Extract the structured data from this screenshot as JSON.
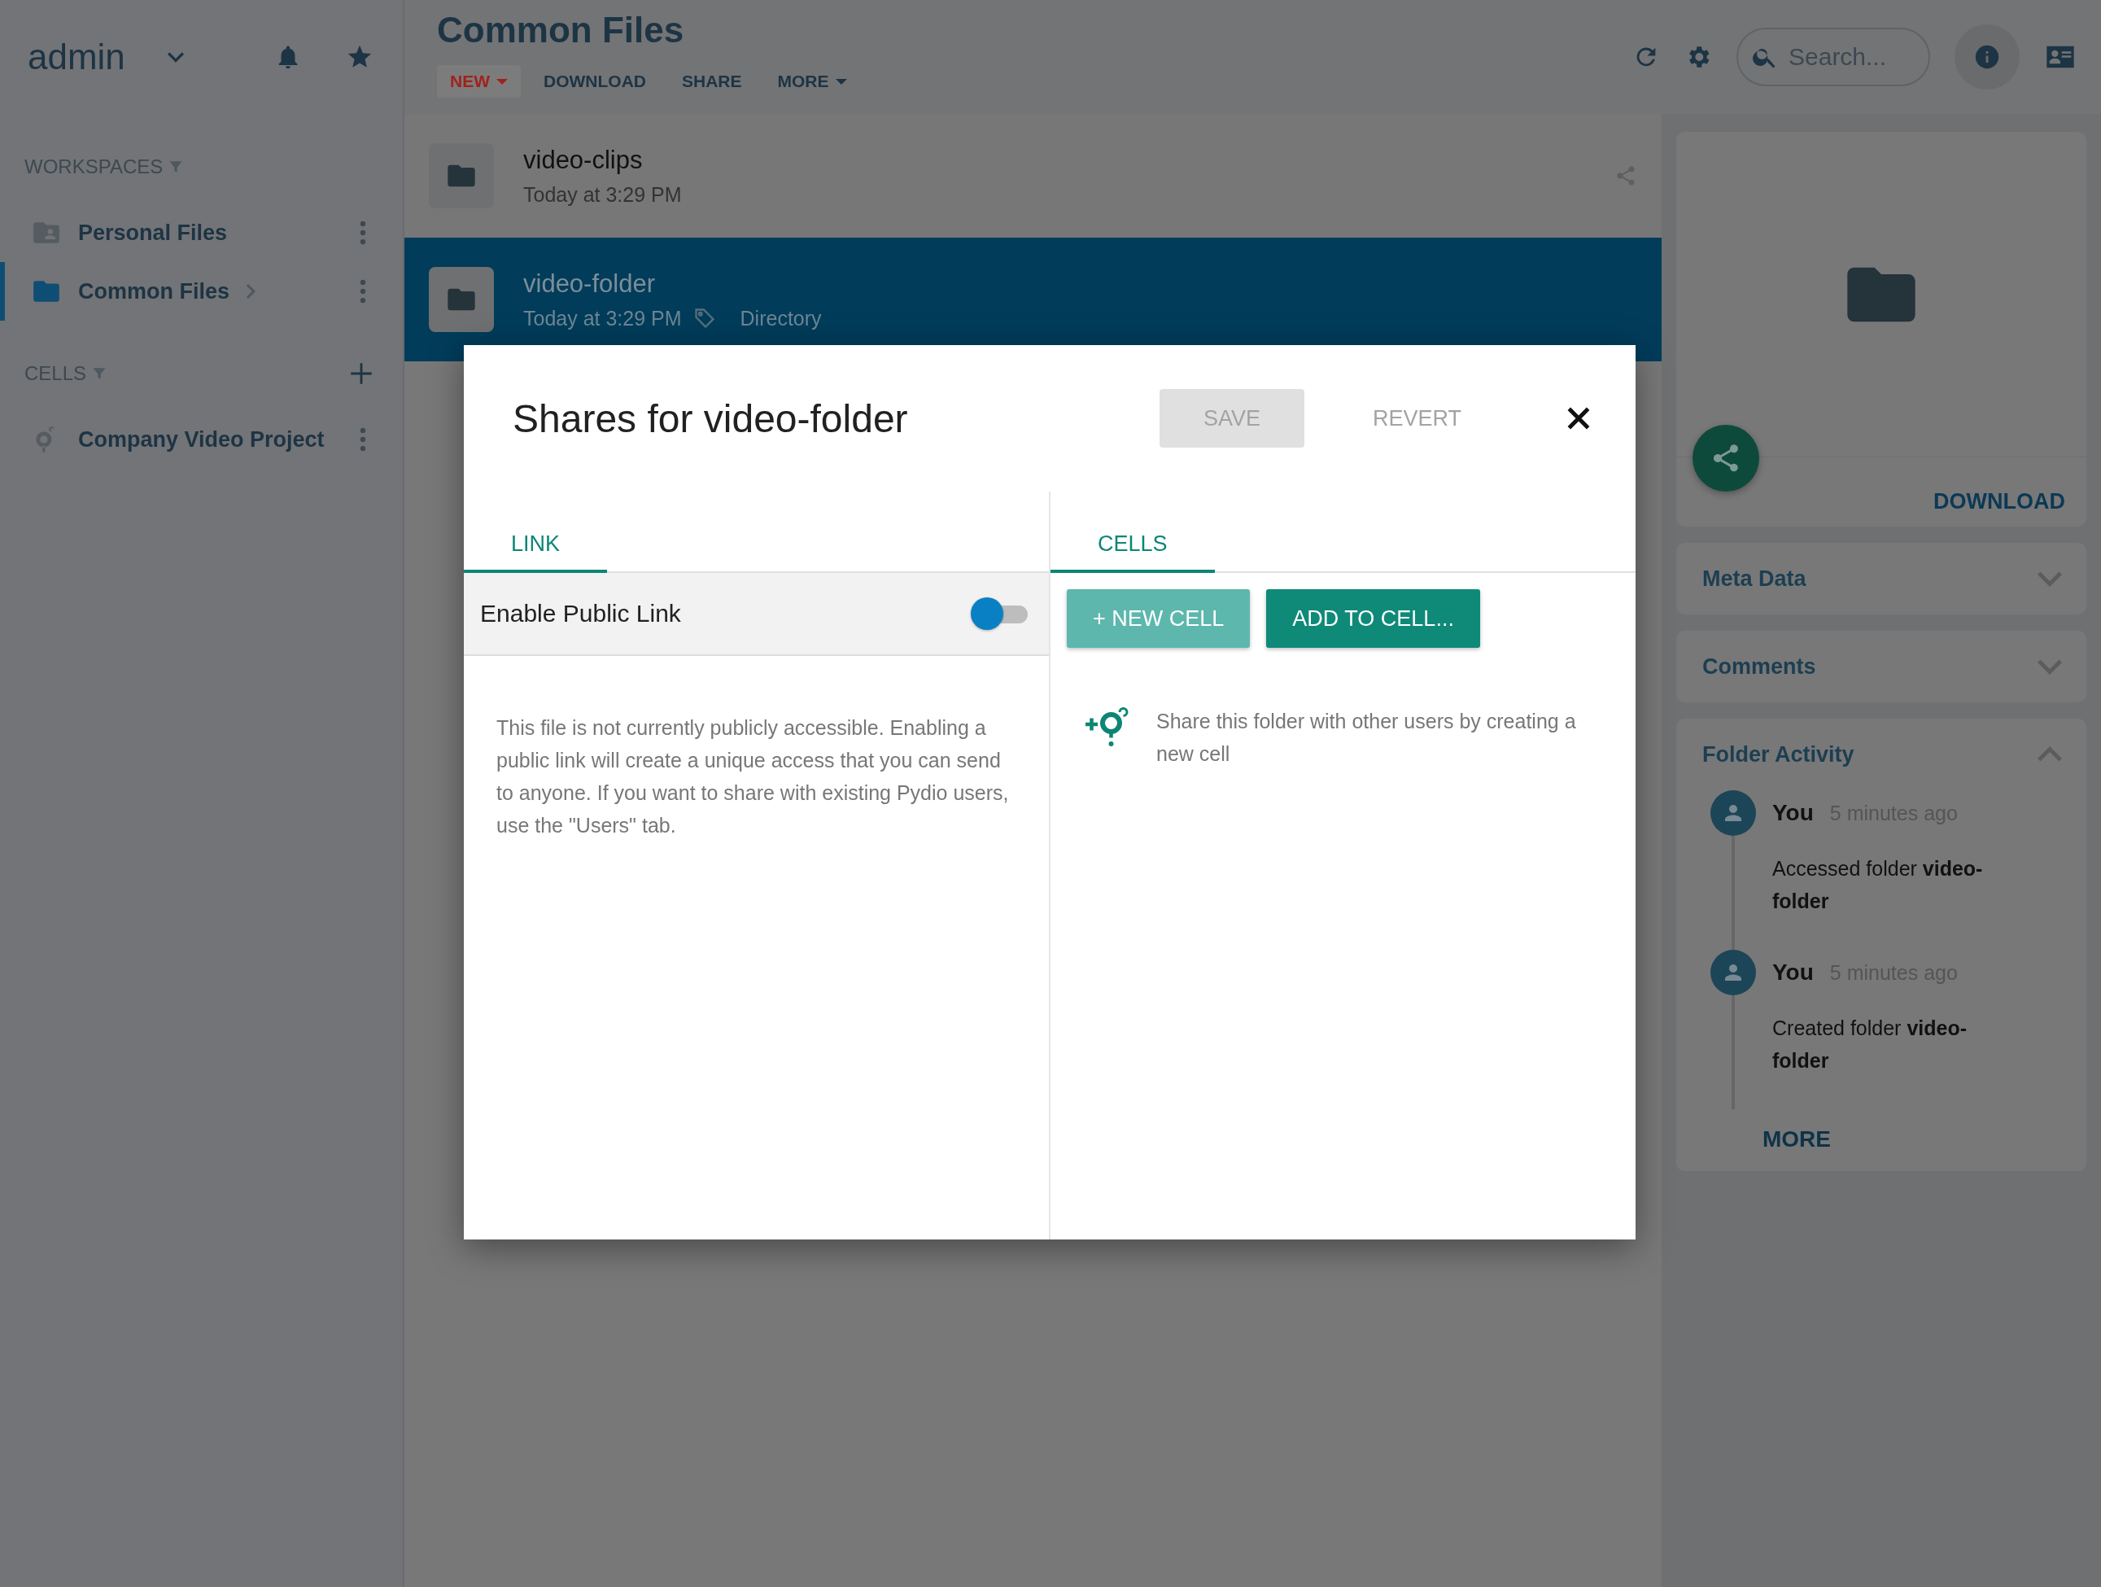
{
  "user_menu": {
    "label": "admin"
  },
  "sidebar": {
    "sections": [
      {
        "title": "WORKSPACES",
        "addable": false,
        "items": [
          {
            "label": "Personal Files",
            "kind": "personal",
            "selected": false,
            "has_children": false
          },
          {
            "label": "Common Files",
            "kind": "folder",
            "selected": true,
            "has_children": true
          }
        ]
      },
      {
        "title": "CELLS",
        "addable": true,
        "items": [
          {
            "label": "Company Video Project",
            "kind": "cell",
            "selected": false,
            "has_children": false
          }
        ]
      }
    ]
  },
  "main": {
    "title": "Common Files",
    "toolbar": [
      {
        "label": "NEW",
        "kind": "primary",
        "dropdown": true
      },
      {
        "label": "DOWNLOAD",
        "kind": "plain",
        "dropdown": false
      },
      {
        "label": "SHARE",
        "kind": "plain",
        "dropdown": false
      },
      {
        "label": "MORE",
        "kind": "plain",
        "dropdown": true
      }
    ]
  },
  "search": {
    "placeholder": "Search..."
  },
  "files": [
    {
      "name": "video-clips",
      "modified": "Today at 3:29 PM",
      "selected": false
    },
    {
      "name": "video-folder",
      "modified": "Today at 3:29 PM",
      "type": "Directory",
      "selected": true
    }
  ],
  "details": {
    "download": "DOWNLOAD",
    "panels": [
      {
        "title": "Meta Data",
        "expanded": false
      },
      {
        "title": "Comments",
        "expanded": false
      },
      {
        "title": "Folder Activity",
        "expanded": true,
        "more": "MORE",
        "activity": [
          {
            "user": "You",
            "time": "5 minutes ago",
            "text": "Accessed folder **video-folder**"
          },
          {
            "user": "You",
            "time": "5 minutes ago",
            "text": "Created folder **video-folder**"
          }
        ]
      }
    ]
  },
  "dialog": {
    "title": "Shares for video-folder",
    "actions": [
      {
        "label": "SAVE",
        "kind": "raised",
        "disabled": true
      },
      {
        "label": "REVERT",
        "kind": "flat",
        "disabled": true
      }
    ],
    "link_pane": {
      "tab": "LINK",
      "public_link": {
        "label": "Enable Public Link",
        "on": false
      },
      "notice": "This file is not currently publicly accessible. Enabling a public link will create a unique access that you can send to anyone. If you want to share with existing Pydio users, use the \"Users\" tab."
    },
    "cells_pane": {
      "tab": "CELLS",
      "buttons": [
        {
          "label": "+ NEW CELL",
          "kind": "light"
        },
        {
          "label": "ADD TO CELL...",
          "kind": "dark"
        }
      ],
      "hint": "Share this folder with other users by creating a new cell"
    }
  }
}
